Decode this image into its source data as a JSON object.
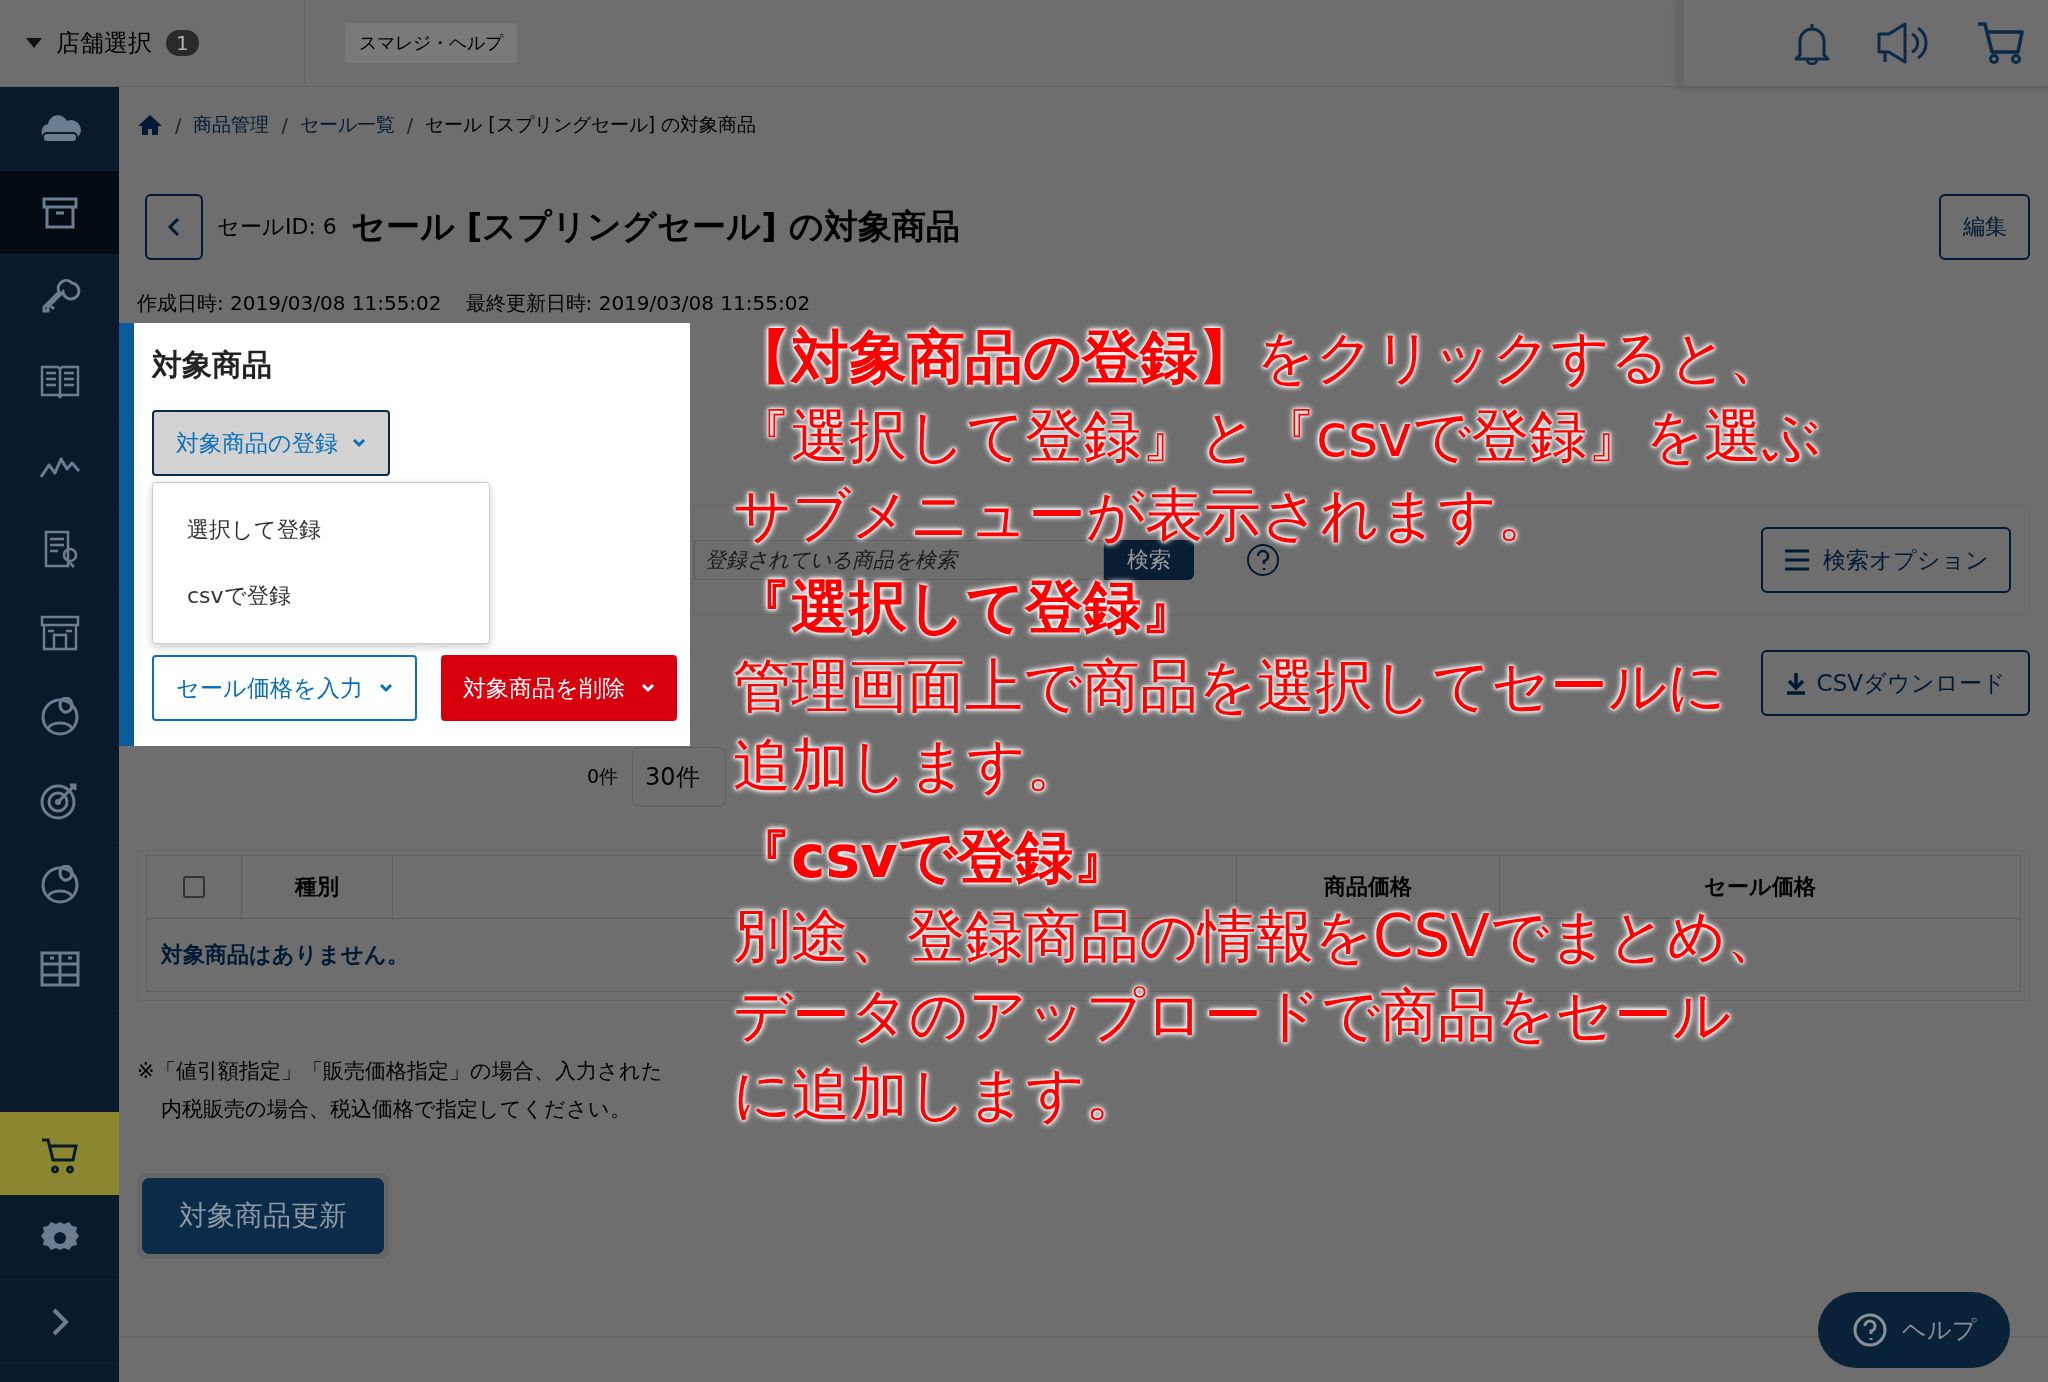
{
  "topbar": {
    "store_selector": {
      "label": "店舗選択",
      "count": "1"
    },
    "help_link": "スマレジ・ヘルプ"
  },
  "sidebar": {
    "items": [
      {
        "selected": false,
        "hovered": false
      },
      {
        "selected": false,
        "hovered": true
      },
      {
        "selected": false,
        "hovered": false
      },
      {
        "selected": false,
        "hovered": false
      },
      {
        "selected": false,
        "hovered": false
      },
      {
        "selected": false,
        "hovered": false
      },
      {
        "selected": false,
        "hovered": false
      },
      {
        "selected": false,
        "hovered": false
      },
      {
        "selected": false,
        "hovered": false
      },
      {
        "selected": false,
        "hovered": false
      },
      {
        "selected": false,
        "hovered": false
      },
      {
        "selected": true,
        "hovered": false
      },
      {
        "selected": false,
        "hovered": false
      },
      {
        "selected": false,
        "hovered": false
      }
    ]
  },
  "breadcrumb": {
    "separator": "/",
    "items": [
      {
        "label": "商品管理",
        "link": true
      },
      {
        "label": "セール一覧",
        "link": true
      },
      {
        "label": "セール [スプリングセール] の対象商品",
        "link": false
      }
    ]
  },
  "header": {
    "id_label": "セールID: 6",
    "title": "セール [スプリングセール] の対象商品",
    "edit_button": "編集"
  },
  "dates": [
    "作成日時: 2019/03/08 11:55:02",
    "最終更新日時: 2019/03/08 11:55:02"
  ],
  "panel": {
    "title": "対象商品",
    "register_button": {
      "label": "対象商品の登録",
      "expanded": true
    },
    "menu": [
      "選択して登録",
      "csvで登録"
    ],
    "buttons": [
      {
        "label": "セール価格を入力",
        "kind": "outline"
      },
      {
        "label": "対象商品を削除",
        "kind": "danger"
      }
    ]
  },
  "search": {
    "placeholder": "登録されている商品を検索",
    "button": "検索",
    "options_button": "検索オプション"
  },
  "csv_button": "CSVダウンロード",
  "pager": {
    "count": "0件",
    "per_page": "30件"
  },
  "table": {
    "select_all_checked": false,
    "columns": [
      {
        "label": "種別"
      },
      {},
      {
        "label": "商品価格"
      },
      {
        "label": "セール価格"
      }
    ],
    "empty_message": "対象商品はありません。"
  },
  "note": [
    "※「値引額指定」「販売価格指定」の場合、入力された",
    "内税販売の場合、税込価格で指定してください。"
  ],
  "update_button": "対象商品更新",
  "help_button": "ヘルプ",
  "annotation": [
    {
      "kind": "intro",
      "lines": [
        "**【対象商品の登録】**をクリックすると、",
        "『選択して登録』と『csvで登録』を選ぶ",
        "サブメニューが表示されます。"
      ]
    },
    {
      "kind": "section",
      "lines": [
        "『選択して登録』",
        "管理画面上で商品を選択してセールに",
        "追加します。"
      ]
    },
    {
      "kind": "section",
      "lines": [
        "『csvで登録』",
        "別途、登録商品の情報をCSVでまとめ、",
        "データのアップロードで商品をセール",
        "に追加します。"
      ]
    }
  ]
}
